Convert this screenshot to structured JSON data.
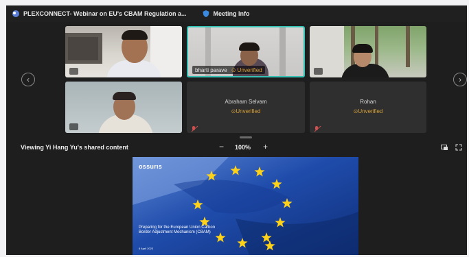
{
  "titlebar": {
    "title": "PLEXCONNECT- Webinar on EU's CBAM Regulation a...",
    "meeting_info_label": "Meeting Info",
    "app_icon": "teams-app-icon",
    "info_icon": "shield-info-icon"
  },
  "participants": [
    {
      "name": "",
      "status": "",
      "video": true
    },
    {
      "name": "bharti parave",
      "status": "Unverified",
      "video": true,
      "active_speaker": true
    },
    {
      "name": "",
      "status": "",
      "video": true
    },
    {
      "name": "",
      "status": "",
      "video": true
    },
    {
      "name": "Abraham Selvam",
      "status": "Unverified",
      "video": false
    },
    {
      "name": "Rohan",
      "status": "Unverified",
      "video": false
    }
  ],
  "nav": {
    "prev_glyph": "‹",
    "next_glyph": "›"
  },
  "share": {
    "label": "Viewing Yi Hang Yu's shared content",
    "zoom_out": "−",
    "zoom_level": "100%",
    "zoom_in": "+"
  },
  "slide": {
    "brand": "ossurıs",
    "title": "Preparing for the European Union Carbon Border Adjustment Mechanism (CBAM)",
    "date": "6 April 2023"
  },
  "colors": {
    "accent_active": "#35c2b4",
    "unverified": "#d6a23a",
    "background": "#1e1e1e",
    "tile": "#2f2f2f"
  }
}
